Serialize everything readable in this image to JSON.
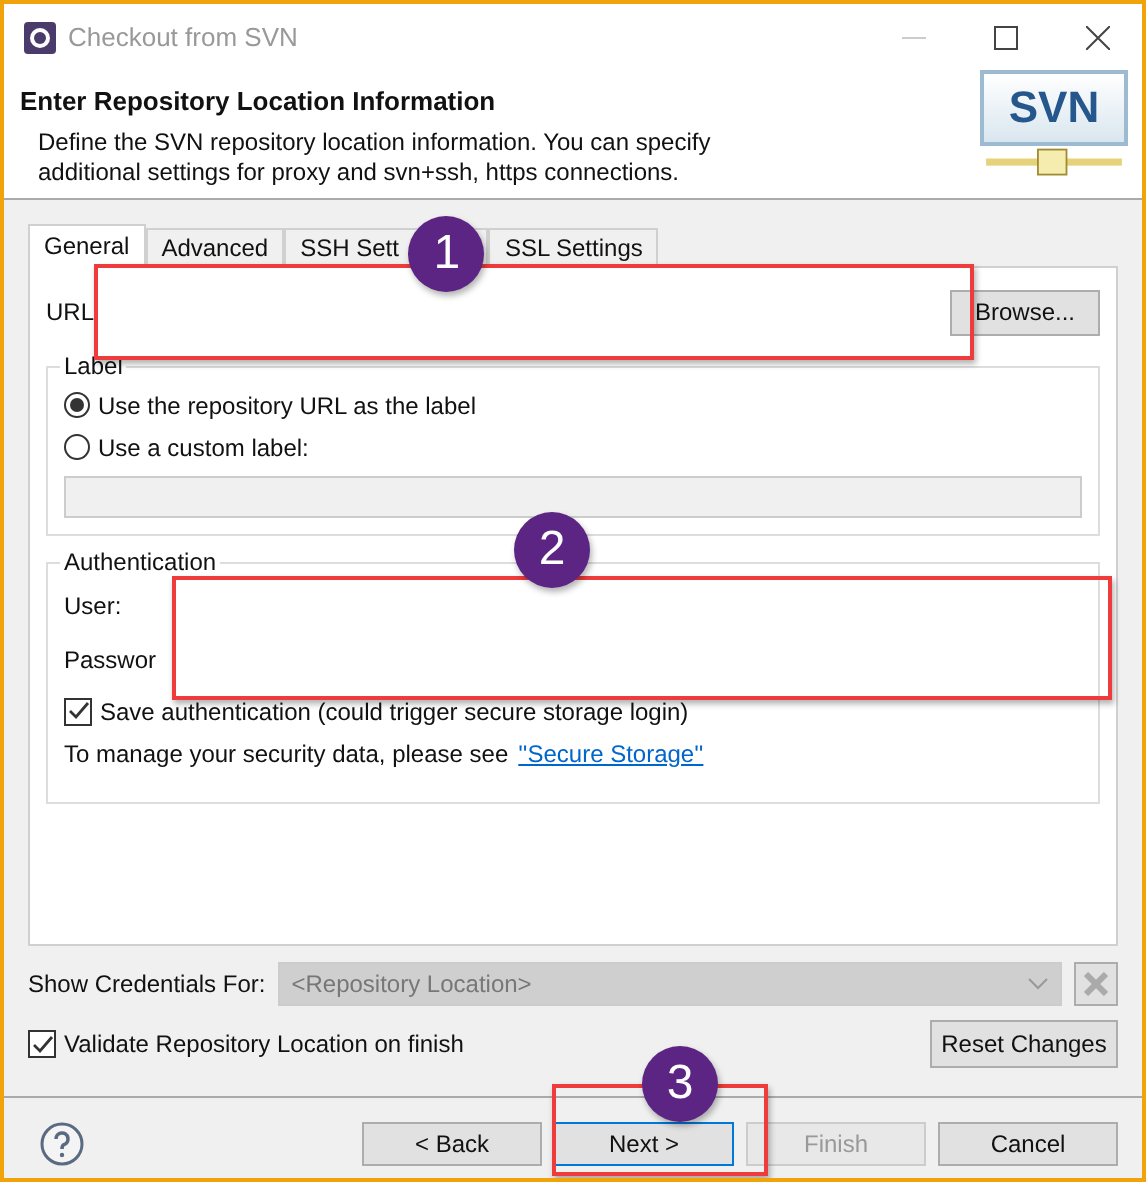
{
  "window": {
    "title": "Checkout from SVN"
  },
  "header": {
    "title": "Enter Repository Location Information",
    "description": "Define the SVN repository location information. You can specify additional settings for proxy and svn+ssh, https connections.",
    "logo_text": "SVN"
  },
  "tabs": [
    {
      "label": "General",
      "selected": true
    },
    {
      "label": "Advanced",
      "selected": false
    },
    {
      "label": "SSH Sett",
      "selected": false
    },
    {
      "label": "SSL Settings",
      "selected": false
    }
  ],
  "url": {
    "label": "URL",
    "browse_button": "Browse..."
  },
  "label_group": {
    "title": "Label",
    "options": [
      {
        "label": "Use the repository URL as the label",
        "selected": true
      },
      {
        "label": "Use a custom label:",
        "selected": false
      }
    ]
  },
  "authentication": {
    "title": "Authentication",
    "user_label": "User:",
    "password_label": "Passwor",
    "save": {
      "label": "Save authentication (could trigger secure storage login)",
      "checked": true
    },
    "note": "To manage your security data, please see",
    "link": "''Secure Storage''"
  },
  "credentials": {
    "label": "Show Credentials For:",
    "placeholder": "<Repository Location>",
    "disabled": true
  },
  "validate": {
    "label": "Validate Repository Location on finish",
    "checked": true
  },
  "reset_button": "Reset Changes",
  "buttons": [
    {
      "label": "< Back",
      "disabled": false,
      "focused": false
    },
    {
      "label": "Next >",
      "disabled": false,
      "focused": true
    },
    {
      "label": "Finish",
      "disabled": true,
      "focused": false
    },
    {
      "label": "Cancel",
      "disabled": false,
      "focused": false
    }
  ],
  "annotations": [
    {
      "number": "1"
    },
    {
      "number": "2"
    },
    {
      "number": "3"
    }
  ]
}
